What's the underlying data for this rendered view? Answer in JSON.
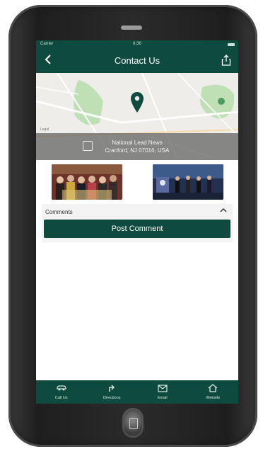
{
  "status_bar": {
    "carrier": "Carrier",
    "time": "8:36"
  },
  "nav": {
    "back_icon": "chevron-left-icon",
    "title": "Contact Us",
    "share_icon": "share-icon"
  },
  "map": {
    "pin_icon": "map-pin-icon",
    "legal": "Legal",
    "address_line1": "National Lead News",
    "address_line2": "Cranford, NJ 07016, USA",
    "directions_icon": "directions-icon"
  },
  "photos": [
    {
      "name": "group-photo"
    },
    {
      "name": "stage-photo"
    }
  ],
  "comments": {
    "label": "Comments",
    "collapse_icon": "chevron-up-icon",
    "post_button": "Post Comment"
  },
  "tab_bar": {
    "items": [
      {
        "label": "Call Us",
        "icon": "car-icon"
      },
      {
        "label": "Directions",
        "icon": "directions-arrow-icon"
      },
      {
        "label": "Email",
        "icon": "mail-icon"
      },
      {
        "label": "Website",
        "icon": "home-icon"
      }
    ]
  },
  "colors": {
    "brand_green": "#0e4a3e",
    "map_park": "#bfe0b5"
  }
}
